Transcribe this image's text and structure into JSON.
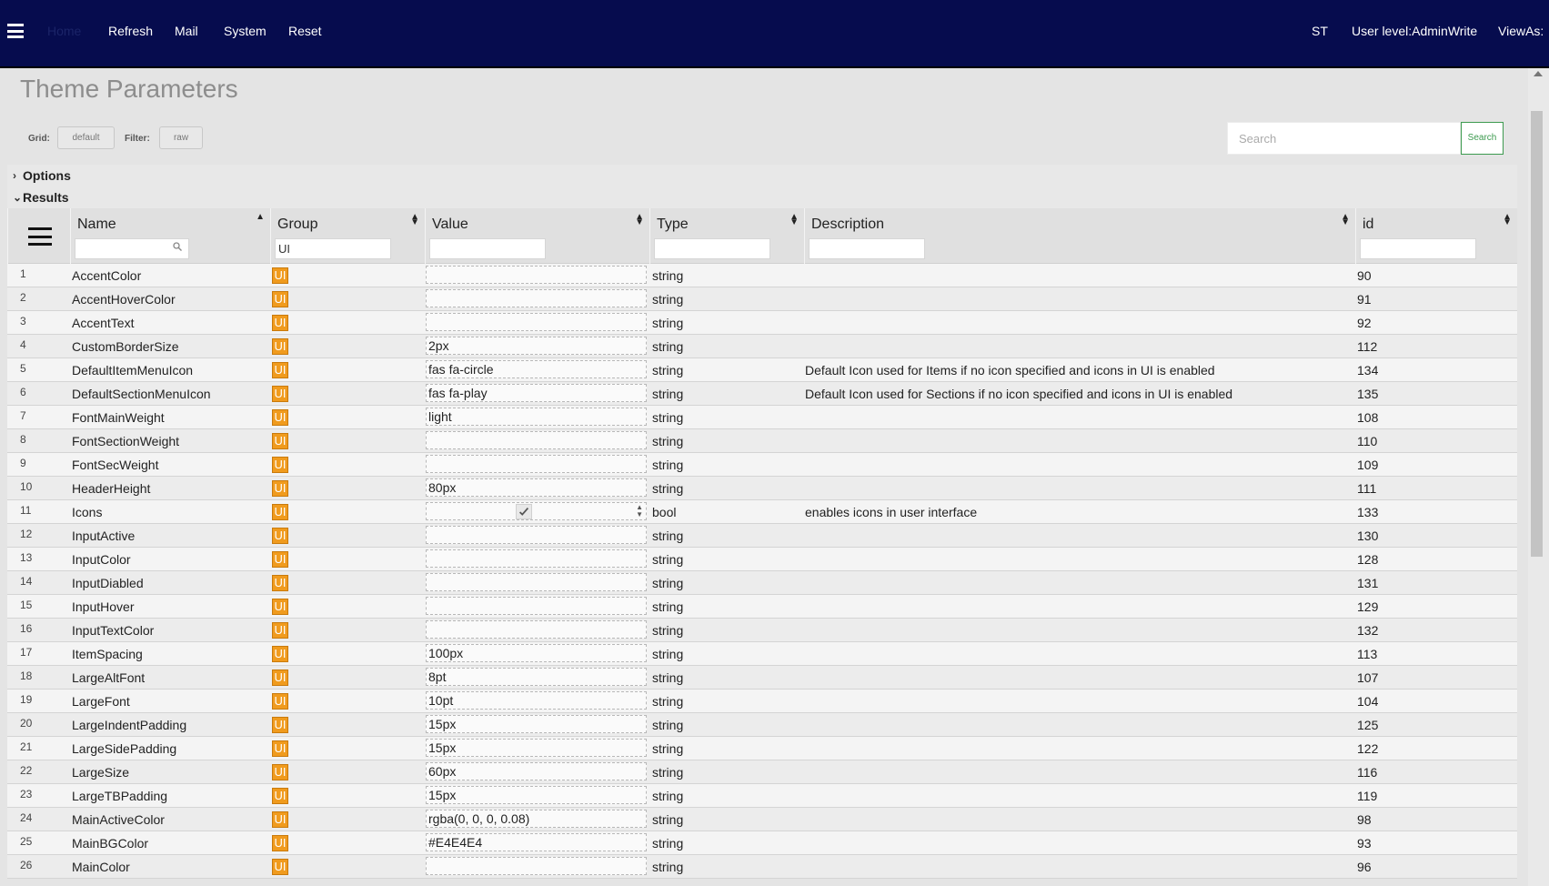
{
  "header": {
    "nav": [
      "Home",
      "Refresh",
      "Mail",
      "System",
      "Reset"
    ],
    "right": [
      "ST",
      "User level:AdminWrite",
      "ViewAs:"
    ]
  },
  "page": {
    "title": "Theme Parameters"
  },
  "controls": {
    "grid_label": "Grid:",
    "grid_value": "default",
    "filter_label": "Filter:",
    "filter_value": "raw",
    "search_placeholder": "Search",
    "search_button": "Search"
  },
  "sections": {
    "options": "Options",
    "results": "Results"
  },
  "grid": {
    "columns": [
      "Name",
      "Group",
      "Value",
      "Type",
      "Description",
      "id"
    ],
    "filters": {
      "name": "",
      "group": "UI",
      "value": "",
      "type": "",
      "description": "",
      "id": ""
    },
    "rows": [
      {
        "idx": "1",
        "name": "AccentColor",
        "group": "UI",
        "value": "",
        "type": "string",
        "description": "",
        "id": "90"
      },
      {
        "idx": "2",
        "name": "AccentHoverColor",
        "group": "UI",
        "value": "",
        "type": "string",
        "description": "",
        "id": "91"
      },
      {
        "idx": "3",
        "name": "AccentText",
        "group": "UI",
        "value": "",
        "type": "string",
        "description": "",
        "id": "92"
      },
      {
        "idx": "4",
        "name": "CustomBorderSize",
        "group": "UI",
        "value": "2px",
        "type": "string",
        "description": "",
        "id": "112"
      },
      {
        "idx": "5",
        "name": "DefaultItemMenuIcon",
        "group": "UI",
        "value": "fas fa-circle",
        "type": "string",
        "description": "Default Icon used for Items if no icon specified and icons in UI is enabled",
        "id": "134"
      },
      {
        "idx": "6",
        "name": "DefaultSectionMenuIcon",
        "group": "UI",
        "value": "fas fa-play",
        "type": "string",
        "description": "Default Icon used for Sections if no icon specified and icons in UI is enabled",
        "id": "135"
      },
      {
        "idx": "7",
        "name": "FontMainWeight",
        "group": "UI",
        "value": "light",
        "type": "string",
        "description": "",
        "id": "108"
      },
      {
        "idx": "8",
        "name": "FontSectionWeight",
        "group": "UI",
        "value": "",
        "type": "string",
        "description": "",
        "id": "110"
      },
      {
        "idx": "9",
        "name": "FontSecWeight",
        "group": "UI",
        "value": "",
        "type": "string",
        "description": "",
        "id": "109"
      },
      {
        "idx": "10",
        "name": "HeaderHeight",
        "group": "UI",
        "value": "80px",
        "type": "string",
        "description": "",
        "id": "111"
      },
      {
        "idx": "11",
        "name": "Icons",
        "group": "UI",
        "value": "",
        "checkbox": true,
        "type": "bool",
        "description": "enables icons in user interface",
        "id": "133"
      },
      {
        "idx": "12",
        "name": "InputActive",
        "group": "UI",
        "value": "",
        "type": "string",
        "description": "",
        "id": "130"
      },
      {
        "idx": "13",
        "name": "InputColor",
        "group": "UI",
        "value": "",
        "type": "string",
        "description": "",
        "id": "128"
      },
      {
        "idx": "14",
        "name": "InputDiabled",
        "group": "UI",
        "value": "",
        "type": "string",
        "description": "",
        "id": "131"
      },
      {
        "idx": "15",
        "name": "InputHover",
        "group": "UI",
        "value": "",
        "type": "string",
        "description": "",
        "id": "129"
      },
      {
        "idx": "16",
        "name": "InputTextColor",
        "group": "UI",
        "value": "",
        "type": "string",
        "description": "",
        "id": "132"
      },
      {
        "idx": "17",
        "name": "ItemSpacing",
        "group": "UI",
        "value": "100px",
        "type": "string",
        "description": "",
        "id": "113"
      },
      {
        "idx": "18",
        "name": "LargeAltFont",
        "group": "UI",
        "value": "8pt",
        "type": "string",
        "description": "",
        "id": "107"
      },
      {
        "idx": "19",
        "name": "LargeFont",
        "group": "UI",
        "value": "10pt",
        "type": "string",
        "description": "",
        "id": "104"
      },
      {
        "idx": "20",
        "name": "LargeIndentPadding",
        "group": "UI",
        "value": "15px",
        "type": "string",
        "description": "",
        "id": "125"
      },
      {
        "idx": "21",
        "name": "LargeSidePadding",
        "group": "UI",
        "value": "15px",
        "type": "string",
        "description": "",
        "id": "122"
      },
      {
        "idx": "22",
        "name": "LargeSize",
        "group": "UI",
        "value": "60px",
        "type": "string",
        "description": "",
        "id": "116"
      },
      {
        "idx": "23",
        "name": "LargeTBPadding",
        "group": "UI",
        "value": "15px",
        "type": "string",
        "description": "",
        "id": "119"
      },
      {
        "idx": "24",
        "name": "MainActiveColor",
        "group": "UI",
        "value": "rgba(0, 0, 0, 0.08)",
        "type": "string",
        "description": "",
        "id": "98"
      },
      {
        "idx": "25",
        "name": "MainBGColor",
        "group": "UI",
        "value": "#E4E4E4",
        "type": "string",
        "description": "",
        "id": "93"
      },
      {
        "idx": "26",
        "name": "MainColor",
        "group": "UI",
        "value": "",
        "type": "string",
        "description": "",
        "id": "96"
      }
    ]
  },
  "colors": {
    "header_bg": "#060c4e",
    "group_badge": "#f09b1e",
    "search_accent": "#3c9a4f"
  }
}
